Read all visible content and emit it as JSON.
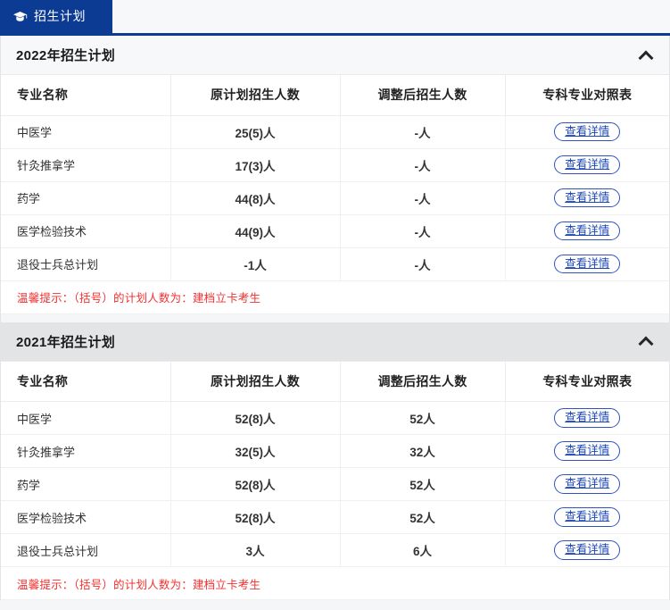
{
  "tab": {
    "label": "招生计划",
    "icon": "graduation-cap-icon",
    "active_bg": "#0b3b92"
  },
  "sections": [
    {
      "title": "2022年招生计划",
      "collapse_icon": "chevron-up-icon",
      "columns": [
        "专业名称",
        "原计划招生人数",
        "调整后招生人数",
        "专科专业对照表"
      ],
      "rows": [
        {
          "major": "中医学",
          "original": "25(5)人",
          "adjusted": "-人",
          "action": "查看详情"
        },
        {
          "major": "针灸推拿学",
          "original": "17(3)人",
          "adjusted": "-人",
          "action": "查看详情"
        },
        {
          "major": "药学",
          "original": "44(8)人",
          "adjusted": "-人",
          "action": "查看详情"
        },
        {
          "major": "医学检验技术",
          "original": "44(9)人",
          "adjusted": "-人",
          "action": "查看详情"
        },
        {
          "major": "退役士兵总计划",
          "original": "-1人",
          "adjusted": "-人",
          "action": "查看详情"
        }
      ],
      "tip": "温馨提示：（括号）的计划人数为：建档立卡考生"
    },
    {
      "title": "2021年招生计划",
      "collapse_icon": "chevron-up-icon",
      "columns": [
        "专业名称",
        "原计划招生人数",
        "调整后招生人数",
        "专科专业对照表"
      ],
      "rows": [
        {
          "major": "中医学",
          "original": "52(8)人",
          "adjusted": "52人",
          "action": "查看详情"
        },
        {
          "major": "针灸推拿学",
          "original": "32(5)人",
          "adjusted": "32人",
          "action": "查看详情"
        },
        {
          "major": "药学",
          "original": "52(8)人",
          "adjusted": "52人",
          "action": "查看详情"
        },
        {
          "major": "医学检验技术",
          "original": "52(8)人",
          "adjusted": "52人",
          "action": "查看详情"
        },
        {
          "major": "退役士兵总计划",
          "original": "3人",
          "adjusted": "6人",
          "action": "查看详情"
        }
      ],
      "tip": "温馨提示：（括号）的计划人数为：建档立卡考生"
    }
  ],
  "colors": {
    "brand_blue": "#0b3b92",
    "link_blue": "#1b46b8",
    "tip_red": "#f3302f",
    "header_shade_a": "#f7f8f9",
    "header_shade_b": "#e3e4e6"
  }
}
